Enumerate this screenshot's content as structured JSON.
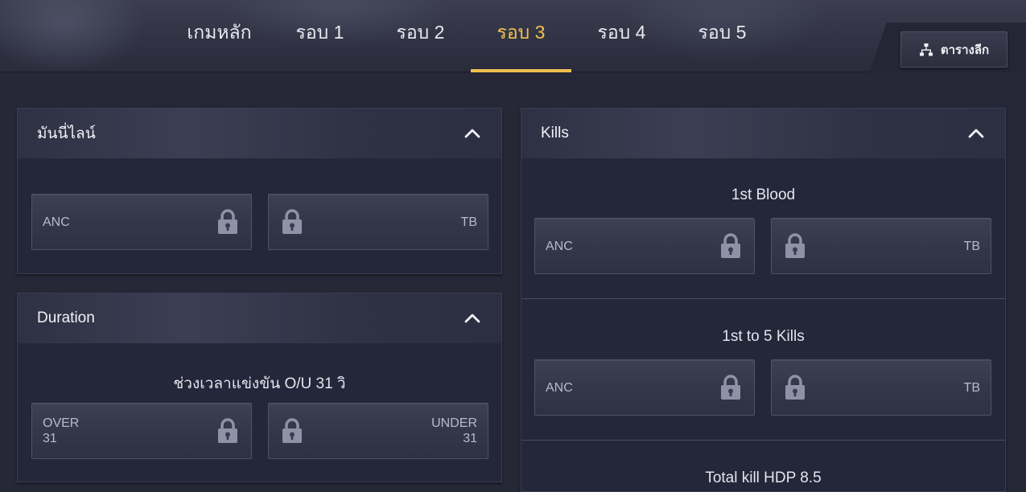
{
  "header": {
    "tabs": [
      {
        "label": "เกมหลัก",
        "active": false
      },
      {
        "label": "รอบ 1",
        "active": false
      },
      {
        "label": "รอบ 2",
        "active": false
      },
      {
        "label": "รอบ 3",
        "active": true
      },
      {
        "label": "รอบ 4",
        "active": false
      },
      {
        "label": "รอบ 5",
        "active": false
      }
    ],
    "bracket_button": {
      "label": "ตารางลีก",
      "icon": "bracket-icon"
    }
  },
  "colors": {
    "accent": "#f3c04e",
    "panel": "#24263a",
    "button": "#34364a"
  },
  "panels": {
    "moneyline": {
      "title": "มันนี่ไลน์",
      "left": {
        "label": "ANC",
        "locked": true
      },
      "right": {
        "label": "TB",
        "locked": true
      }
    },
    "duration": {
      "title": "Duration",
      "subtitle": "ช่วงเวลาแข่งขัน O/U 31 วิ",
      "left": {
        "label": "OVER",
        "value": "31",
        "locked": true
      },
      "right": {
        "label": "UNDER",
        "value": "31",
        "locked": true
      }
    },
    "kills": {
      "title": "Kills",
      "first_blood": {
        "title": "1st Blood",
        "left": {
          "label": "ANC",
          "locked": true
        },
        "right": {
          "label": "TB",
          "locked": true
        }
      },
      "first_to_5": {
        "title": "1st to 5 Kills",
        "left": {
          "label": "ANC",
          "locked": true
        },
        "right": {
          "label": "TB",
          "locked": true
        }
      },
      "total_hdp": {
        "title": "Total kill HDP 8.5"
      }
    }
  }
}
